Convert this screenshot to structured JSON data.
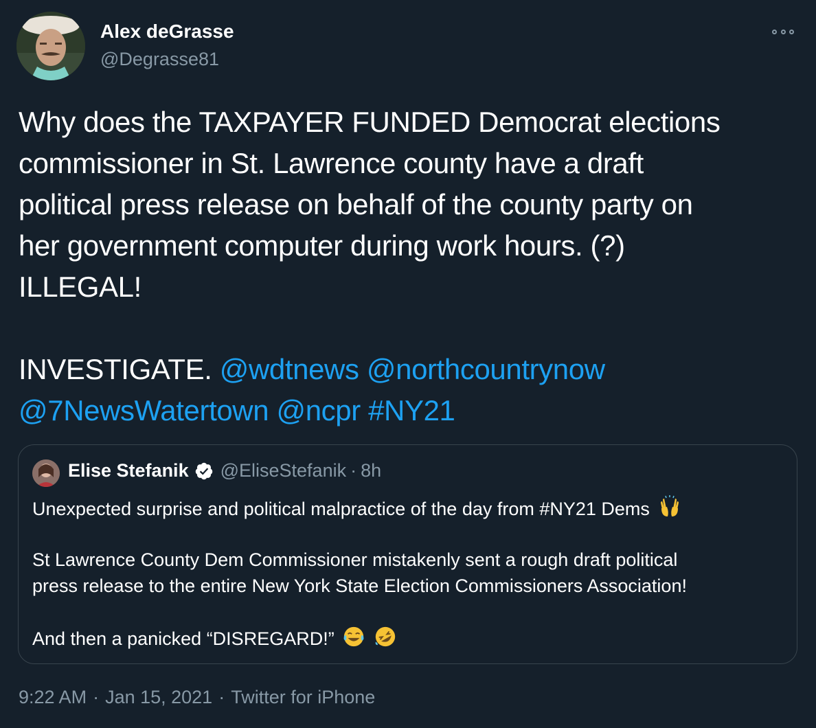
{
  "author": {
    "name": "Alex deGrasse",
    "handle": "@Degrasse81"
  },
  "tweet": {
    "lines": [
      "Why does the TAXPAYER FUNDED Democrat elections",
      "commissioner in St. Lawrence county have a draft",
      "political press release on behalf of the county party on",
      "her government computer during work hours. (?)",
      "ILLEGAL!"
    ],
    "investigate": "INVESTIGATE.",
    "mentions": [
      "@wdtnews",
      "@northcountrynow",
      "@7NewsWatertown",
      "@ncpr"
    ],
    "hashtag": "#NY21"
  },
  "quote": {
    "name": "Elise Stefanik",
    "handle": "@EliseStefanik",
    "separator": "·",
    "time": "8h",
    "paragraph1": "Unexpected surprise and political malpractice of the day from #NY21 Dems",
    "paragraph2_line1": "St Lawrence County Dem Commissioner mistakenly sent a rough draft political",
    "paragraph2_line2": "press release to the entire New York State Election Commissioners Association!",
    "paragraph3": "And then a panicked “DISREGARD!”"
  },
  "meta": {
    "time": "9:22 AM",
    "date": "Jan 15, 2021",
    "source": "Twitter for iPhone",
    "separator": "·"
  },
  "colors": {
    "background": "#15202b",
    "link": "#1da1f2",
    "secondary": "#8899a6",
    "border": "#38444d"
  }
}
